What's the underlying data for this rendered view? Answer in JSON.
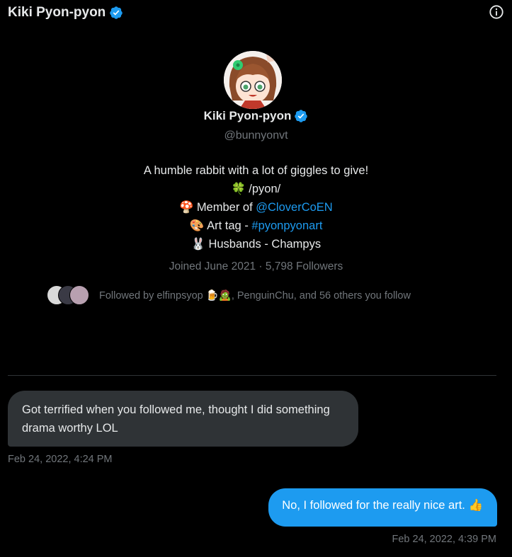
{
  "header": {
    "title": "Kiki Pyon-pyon",
    "verified_icon": "verified-badge-icon",
    "info_icon": "info-icon"
  },
  "profile": {
    "name": "Kiki Pyon-pyon",
    "handle": "@bunnyonvt",
    "bio": [
      {
        "emoji": "",
        "text": "A humble rabbit with a lot of giggles to give!",
        "link": ""
      },
      {
        "emoji": "🍀",
        "text": "/pyon/",
        "link": ""
      },
      {
        "emoji": "🍄",
        "text": "Member of ",
        "link": "@CloverCoEN"
      },
      {
        "emoji": "🎨",
        "text": "Art tag - ",
        "link": "#pyonpyonart"
      },
      {
        "emoji": "🐰",
        "text": "Husbands - Champys",
        "link": ""
      }
    ],
    "meta": "Joined June 2021 · 5,798 Followers",
    "followed_by": "Followed by elfinpsyop 🍺🧟, PenguinChu, and 56 others you follow"
  },
  "messages": [
    {
      "direction": "in",
      "text": "Got terrified when you followed me, thought I did something drama worthy LOL",
      "time": "Feb 24, 2022, 4:24 PM"
    },
    {
      "direction": "out",
      "text": "No, I followed for the really nice art. 👍",
      "time": "Feb 24, 2022, 4:39 PM"
    }
  ],
  "colors": {
    "background": "#000000",
    "accent": "#1d9bf0",
    "incoming_bubble": "#2f3336",
    "muted_text": "#71767b"
  }
}
